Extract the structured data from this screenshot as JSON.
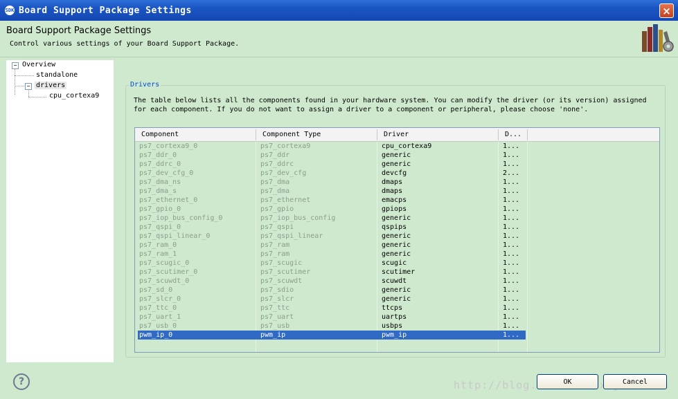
{
  "window": {
    "title": "Board Support Package Settings",
    "app_icon": "SDK",
    "close_icon": "close-icon",
    "accent": "#1a55c2"
  },
  "header": {
    "title": "Board Support Package Settings",
    "description": "Control various settings of your Board Support Package.",
    "icon": "books-gear-icon"
  },
  "tree": {
    "items": [
      {
        "label": "Overview",
        "expanded": true,
        "level": 0
      },
      {
        "label": "standalone",
        "level": 1
      },
      {
        "label": "drivers",
        "expanded": true,
        "selected": true,
        "level": 1
      },
      {
        "label": "cpu_cortexa9",
        "level": 2
      }
    ]
  },
  "drivers": {
    "group_label": "Drivers",
    "description": "The table below lists all the components found in your hardware system. You can modify the driver (or its version) assigned for each component. If you do not want to assign a driver to a component or peripheral, please choose 'none'.",
    "columns": [
      "Component",
      "Component Type",
      "Driver",
      "D..."
    ],
    "rows": [
      [
        "ps7_cortexa9_0",
        "ps7_cortexa9",
        "cpu_cortexa9",
        "1..."
      ],
      [
        "ps7_ddr_0",
        "ps7_ddr",
        "generic",
        "1..."
      ],
      [
        "ps7_ddrc_0",
        "ps7_ddrc",
        "generic",
        "1..."
      ],
      [
        "ps7_dev_cfg_0",
        "ps7_dev_cfg",
        "devcfg",
        "2..."
      ],
      [
        "ps7_dma_ns",
        "ps7_dma",
        "dmaps",
        "1..."
      ],
      [
        "ps7_dma_s",
        "ps7_dma",
        "dmaps",
        "1..."
      ],
      [
        "ps7_ethernet_0",
        "ps7_ethernet",
        "emacps",
        "1..."
      ],
      [
        "ps7_gpio_0",
        "ps7_gpio",
        "gpiops",
        "1..."
      ],
      [
        "ps7_iop_bus_config_0",
        "ps7_iop_bus_config",
        "generic",
        "1..."
      ],
      [
        "ps7_qspi_0",
        "ps7_qspi",
        "qspips",
        "1..."
      ],
      [
        "ps7_qspi_linear_0",
        "ps7_qspi_linear",
        "generic",
        "1..."
      ],
      [
        "ps7_ram_0",
        "ps7_ram",
        "generic",
        "1..."
      ],
      [
        "ps7_ram_1",
        "ps7_ram",
        "generic",
        "1..."
      ],
      [
        "ps7_scugic_0",
        "ps7_scugic",
        "scugic",
        "1..."
      ],
      [
        "ps7_scutimer_0",
        "ps7_scutimer",
        "scutimer",
        "1..."
      ],
      [
        "ps7_scuwdt_0",
        "ps7_scuwdt",
        "scuwdt",
        "1..."
      ],
      [
        "ps7_sd_0",
        "ps7_sdio",
        "generic",
        "1..."
      ],
      [
        "ps7_slcr_0",
        "ps7_slcr",
        "generic",
        "1..."
      ],
      [
        "ps7_ttc_0",
        "ps7_ttc",
        "ttcps",
        "1..."
      ],
      [
        "ps7_uart_1",
        "ps7_uart",
        "uartps",
        "1..."
      ],
      [
        "ps7_usb_0",
        "ps7_usb",
        "usbps",
        "1..."
      ],
      [
        "pwm_ip_0",
        "pwm_ip",
        "pwm_ip",
        "1..."
      ]
    ],
    "selected_row": 21
  },
  "footer": {
    "help_icon": "help-icon",
    "help_glyph": "?",
    "ok_label": "OK",
    "cancel_label": "Cancel",
    "watermark": "http://blog.csdn.net/xzyiverson"
  }
}
